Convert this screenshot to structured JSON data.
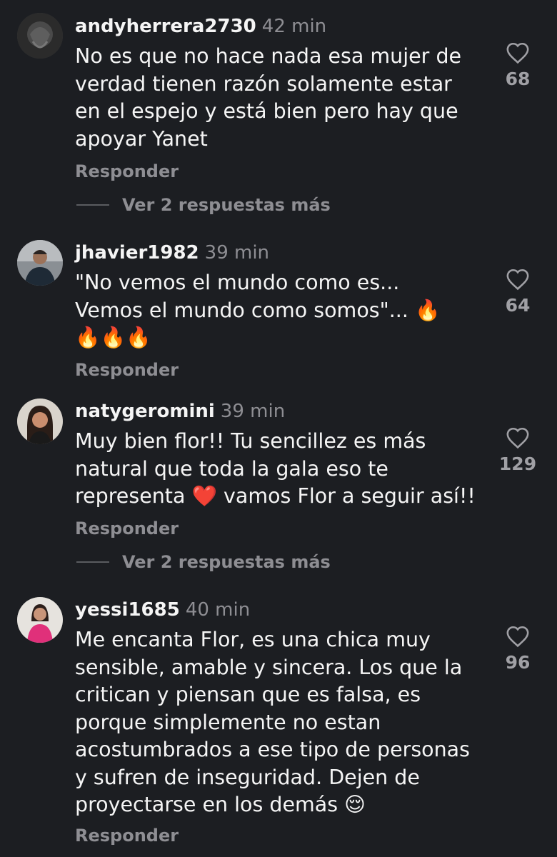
{
  "comments": [
    {
      "username": "andyherrera2730",
      "time": "42 min",
      "avatar_icon": "sculpture-avatar",
      "lines": [
        "No es que no hace nada esa mujer de",
        "verdad tienen razón solamente estar",
        "en el espejo y está bien pero hay que",
        "apoyar Yanet"
      ],
      "likes": "68",
      "reply_label": "Responder",
      "more_replies": "Ver 2 respuestas más"
    },
    {
      "username": "jhavier1982",
      "time": "39 min",
      "avatar_icon": "man-selfie-avatar",
      "lines": [
        "\"No vemos el mundo como es...",
        "Vemos el mundo como somos\"... 🔥",
        "🔥🔥🔥"
      ],
      "likes": "64",
      "reply_label": "Responder"
    },
    {
      "username": "natygeromini",
      "time": "39 min",
      "avatar_icon": "woman-avatar",
      "lines": [
        "Muy bien flor!! Tu sencillez es más",
        "natural que toda la gala eso te",
        "representa ❤️ vamos Flor a seguir así!!"
      ],
      "likes": "129",
      "reply_label": "Responder",
      "more_replies": "Ver 2 respuestas más"
    },
    {
      "username": "yessi1685",
      "time": "40 min",
      "avatar_icon": "woman-pink-shirt-avatar",
      "lines": [
        "Me encanta Flor, es una chica muy",
        "sensible, amable y sincera. Los que la",
        "critican y piensan que es falsa, es",
        "porque simplemente no estan",
        "acostumbrados a ese tipo de personas",
        "y sufren de inseguridad. Dejen de",
        "proyectarse en los demás 😌"
      ],
      "likes": "96",
      "reply_label": "Responder"
    }
  ],
  "colors": {
    "background": "#1c1e22",
    "text": "#f5f5f5",
    "muted": "#8e8e93"
  }
}
